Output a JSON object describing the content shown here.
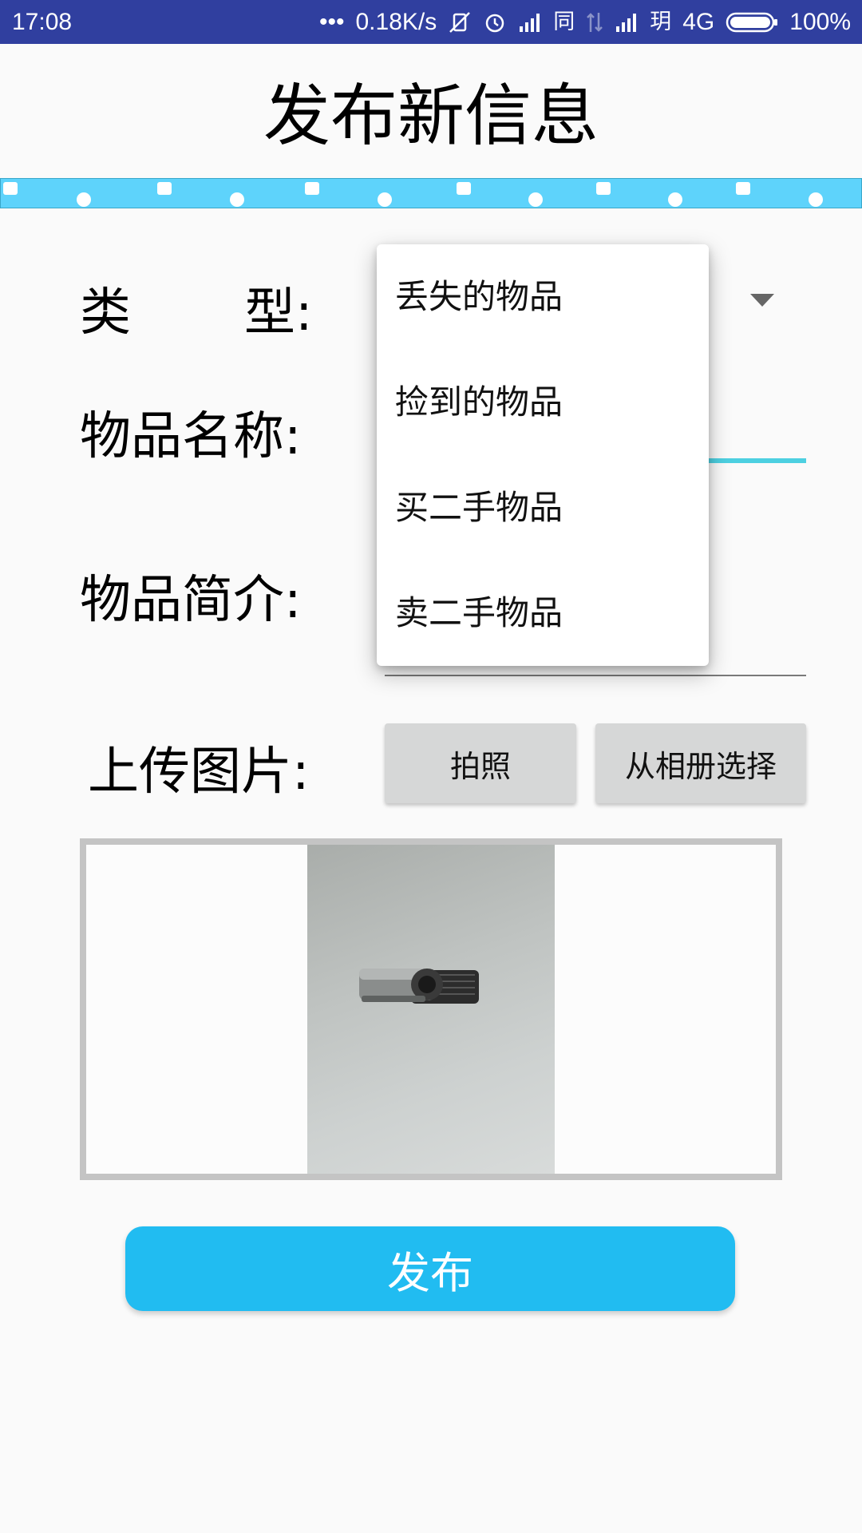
{
  "status_bar": {
    "time": "17:08",
    "dots": "•••",
    "net_speed": "0.18K/s",
    "sim1_label": "同",
    "sim2_label": "玥",
    "network_type": "4G",
    "battery": "100%",
    "icons": [
      "mute-vibrate-icon",
      "alarm-icon",
      "signal-icon",
      "data-transfer-icon",
      "signal-icon",
      "battery-icon"
    ]
  },
  "header": {
    "title": "发布新信息"
  },
  "form": {
    "type_label_1": "类",
    "type_label_2": "型:",
    "name_label": "物品名称:",
    "desc_label": "物品简介:",
    "upload_label": "上传图片:"
  },
  "dropdown": {
    "options": [
      "丢失的物品",
      "捡到的物品",
      "买二手物品",
      "卖二手物品"
    ]
  },
  "buttons": {
    "camera": "拍照",
    "album": "从相册选择",
    "publish": "发布"
  },
  "colors": {
    "status_bar": "#303f9f",
    "divider": "#5ed3fb",
    "accent": "#21bcf1",
    "input_focus": "#4dd0e1"
  }
}
